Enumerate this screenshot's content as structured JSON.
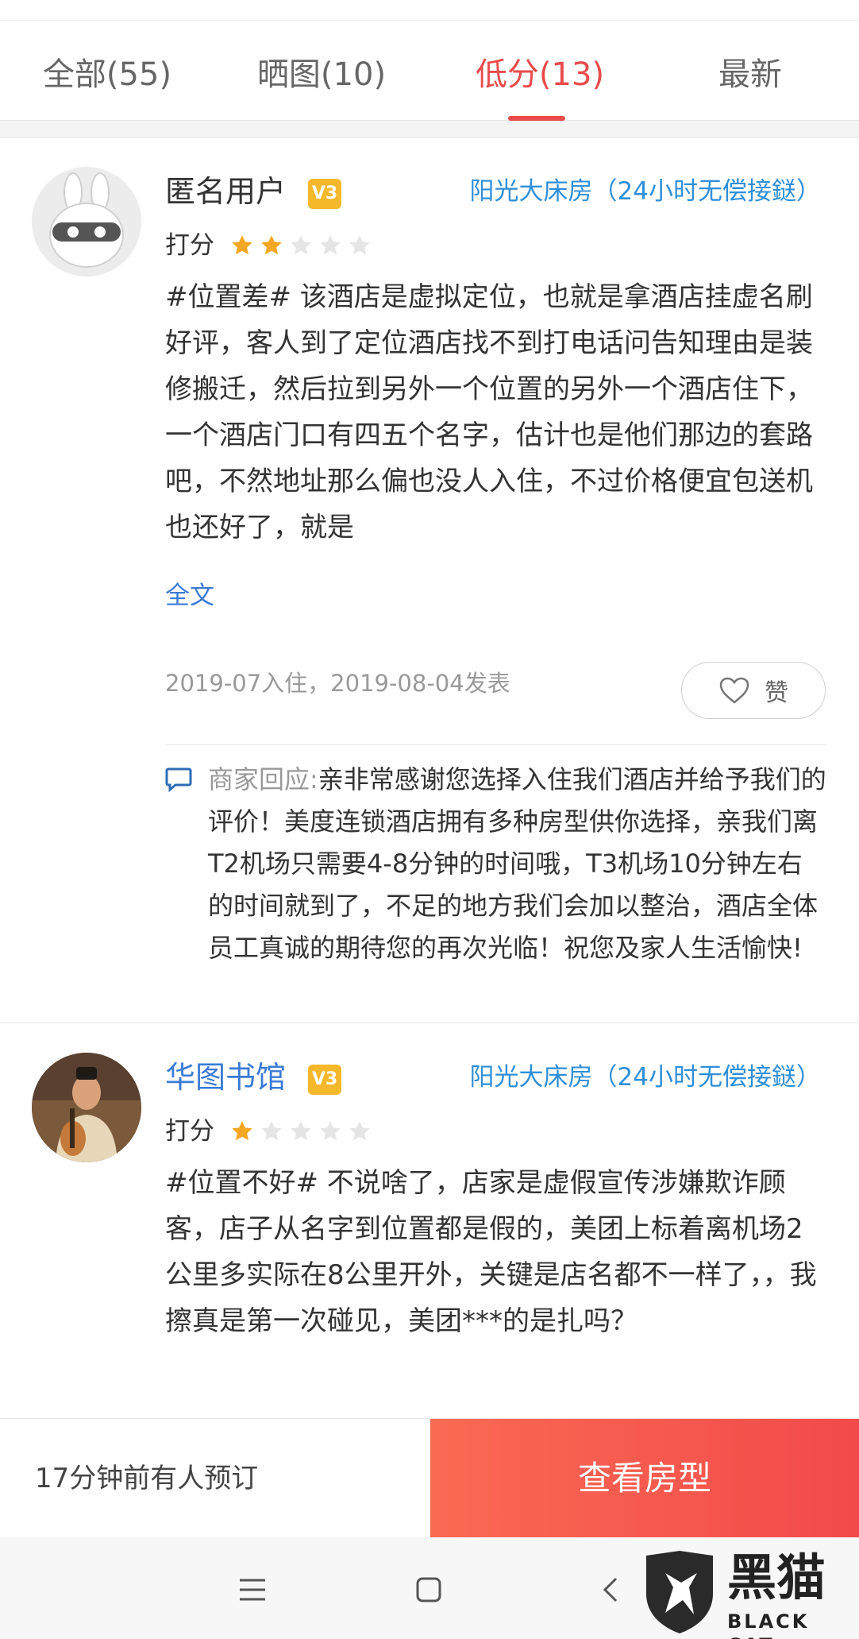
{
  "tabs": [
    {
      "label": "全部(55)"
    },
    {
      "label": "晒图(10)"
    },
    {
      "label": "低分(13)"
    },
    {
      "label": "最新"
    }
  ],
  "active_tab_color": "#e84b4b",
  "reviews": [
    {
      "username": "匿名用户",
      "vip_badge": "V3",
      "room_type": "阳光大床房（24小时无偿接鎹）",
      "score_label": "打分",
      "rating": 2,
      "rating_max": 5,
      "content": "#位置差# 该酒店是虚拟定位，也就是拿酒店挂虚名刷好评，客人到了定位酒店找不到打电话问告知理由是装修搬迁，然后拉到另外一个位置的另外一个酒店住下，一个酒店门口有四五个名字，估计也是他们那边的套路吧，不然地址那么偏也没人入住，不过价格便宜包送机也还好了，就是",
      "full_text_link": "全文",
      "meta": "2019-07入住，2019-08-04发表",
      "like_label": "赞",
      "merchant_reply_label": "商家回应:",
      "merchant_reply": "亲非常感谢您选择入住我们酒店并给予我们的评价！美度连锁酒店拥有多种房型供你选择，亲我们离T2机场只需要4-8分钟的时间哦，T3机场10分钟左右的时间就到了，不足的地方我们会加以整治，酒店全体员工真诚的期待您的再次光临！祝您及家人生活愉快!"
    },
    {
      "username": "华图书馆",
      "vip_badge": "V3",
      "room_type": "阳光大床房（24小时无偿接鎹）",
      "score_label": "打分",
      "rating": 1,
      "rating_max": 5,
      "content": "#位置不好# 不说啥了，店家是虚假宣传涉嫌欺诈顾客，店子从名字到位置都是假的，美团上标着离机场2公里多实际在8公里开外，关键是店名都不一样了，，我擦真是第一次碰见，美团***的是扎吗？"
    }
  ],
  "bottom_bar": {
    "booking_hint": "17分钟前有人预订",
    "view_rooms_label": "查看房型"
  },
  "nav_icons": [
    "menu-icon",
    "home-icon",
    "back-icon"
  ],
  "watermark": {
    "cn": "黑猫",
    "en": "BLACK CAT"
  },
  "colors": {
    "accent_red": "#e84b4b",
    "link_blue": "#2f8fd8",
    "star_orange": "#f5a623",
    "star_gray": "#e5e5e5",
    "badge_gold": "#f5b82a"
  }
}
